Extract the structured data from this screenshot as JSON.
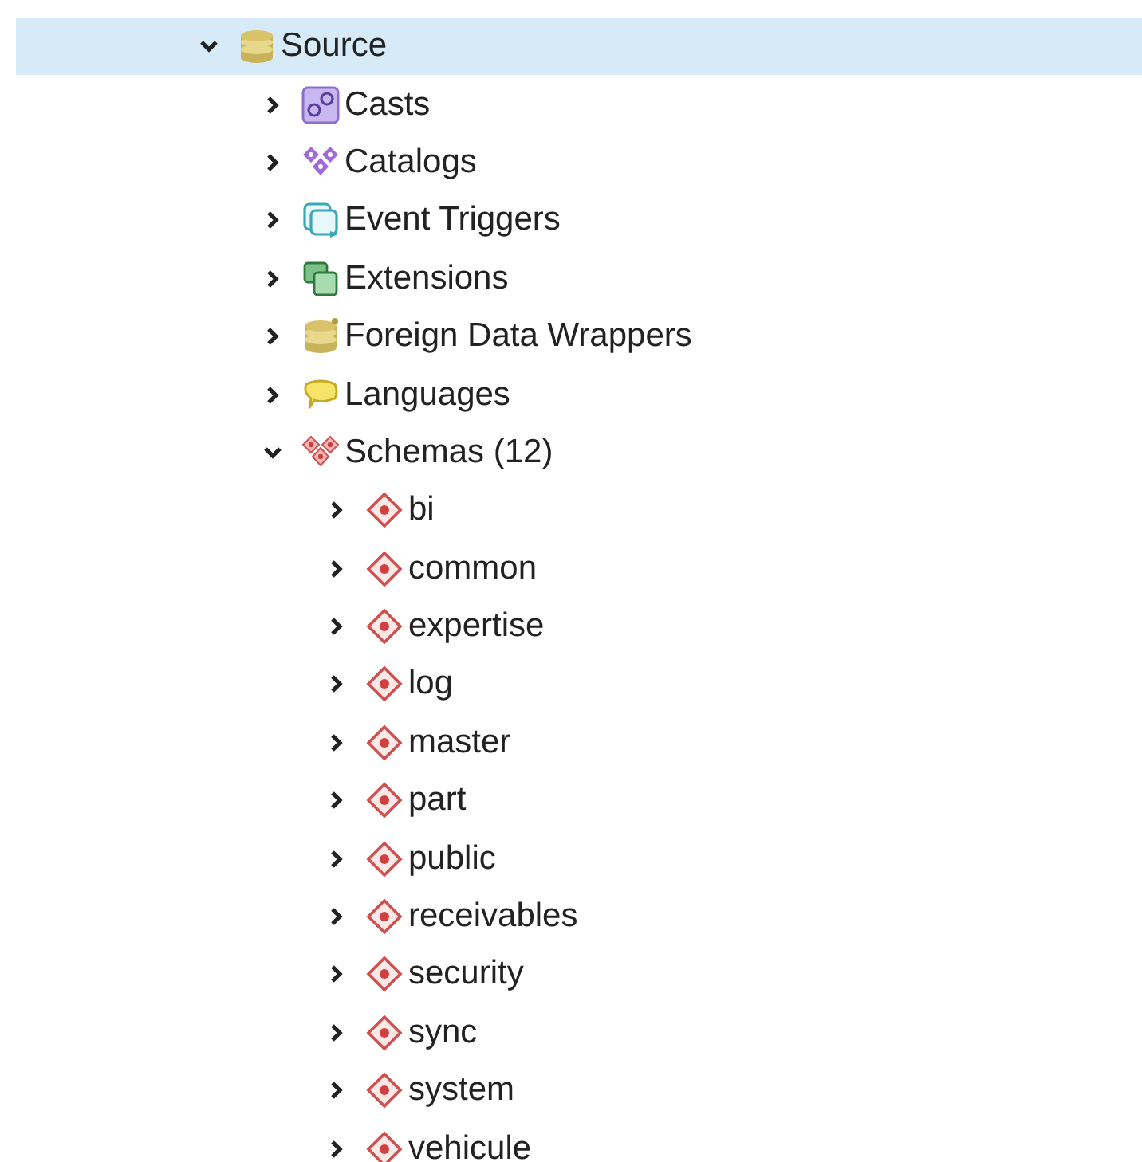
{
  "tree": [
    {
      "label": "Source",
      "kind": "database",
      "selected": true,
      "expanded": true,
      "children": [
        {
          "label": "Casts",
          "kind": "cast",
          "selected": false,
          "expanded": false
        },
        {
          "label": "Catalogs",
          "kind": "catalog",
          "selected": false,
          "expanded": false
        },
        {
          "label": "Event Triggers",
          "kind": "trigger",
          "selected": false,
          "expanded": false
        },
        {
          "label": "Extensions",
          "kind": "extension",
          "selected": false,
          "expanded": false
        },
        {
          "label": "Foreign Data Wrappers",
          "kind": "fdw",
          "selected": false,
          "expanded": false
        },
        {
          "label": "Languages",
          "kind": "language",
          "selected": false,
          "expanded": false
        },
        {
          "label": "Schemas (12)",
          "kind": "schemas",
          "selected": false,
          "expanded": true,
          "children": [
            {
              "label": "bi",
              "kind": "schema",
              "selected": false,
              "expanded": false
            },
            {
              "label": "common",
              "kind": "schema",
              "selected": false,
              "expanded": false
            },
            {
              "label": "expertise",
              "kind": "schema",
              "selected": false,
              "expanded": false
            },
            {
              "label": "log",
              "kind": "schema",
              "selected": false,
              "expanded": false
            },
            {
              "label": "master",
              "kind": "schema",
              "selected": false,
              "expanded": false
            },
            {
              "label": "part",
              "kind": "schema",
              "selected": false,
              "expanded": false
            },
            {
              "label": "public",
              "kind": "schema",
              "selected": false,
              "expanded": false
            },
            {
              "label": "receivables",
              "kind": "schema",
              "selected": false,
              "expanded": false
            },
            {
              "label": "security",
              "kind": "schema",
              "selected": false,
              "expanded": false
            },
            {
              "label": "sync",
              "kind": "schema",
              "selected": false,
              "expanded": false
            },
            {
              "label": "system",
              "kind": "schema",
              "selected": false,
              "expanded": false
            },
            {
              "label": "vehicule",
              "kind": "schema",
              "selected": false,
              "expanded": false
            }
          ]
        }
      ]
    }
  ]
}
